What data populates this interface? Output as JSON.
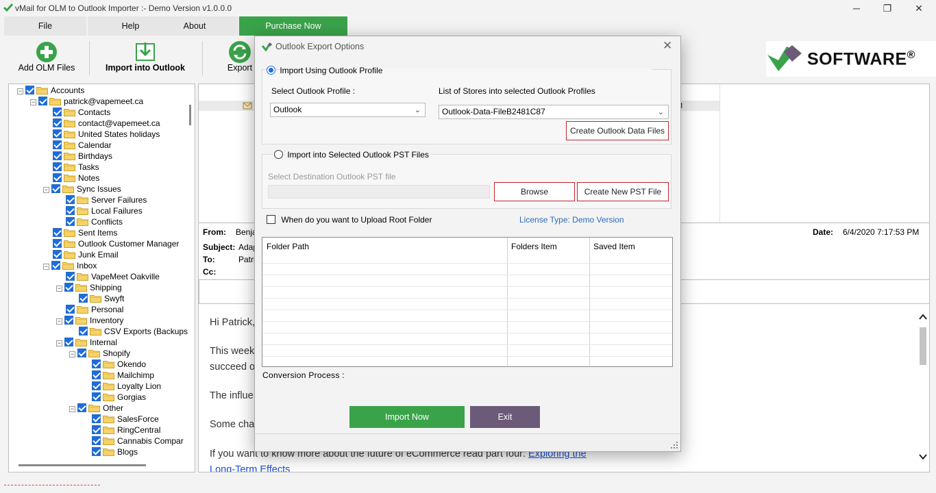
{
  "window": {
    "title": "vMail for OLM to Outlook Importer :- Demo Version v1.0.0.0",
    "minimize": "─",
    "restore": "❐",
    "close": "✕"
  },
  "menu": {
    "file": "File",
    "help": "Help",
    "about": "About",
    "purchase": "Purchase Now"
  },
  "toolbar": {
    "add_olm": "Add OLM Files",
    "import_outlook": "Import into Outlook",
    "export": "Export"
  },
  "brand": {
    "word": "SOFTWARE",
    "reg": "®"
  },
  "tree": {
    "nodes": [
      {
        "label": "Accounts"
      },
      {
        "label": "patrick@vapemeet.ca"
      },
      {
        "label": "Contacts"
      },
      {
        "label": "contact@vapemeet.ca"
      },
      {
        "label": "United States holidays"
      },
      {
        "label": "Calendar"
      },
      {
        "label": "Birthdays"
      },
      {
        "label": "Tasks"
      },
      {
        "label": "Notes"
      },
      {
        "label": "Sync Issues"
      },
      {
        "label": "Server Failures"
      },
      {
        "label": "Local Failures"
      },
      {
        "label": "Conflicts"
      },
      {
        "label": "Sent Items"
      },
      {
        "label": "Outlook Customer Manager"
      },
      {
        "label": "Junk Email"
      },
      {
        "label": "Inbox"
      },
      {
        "label": "VapeMeet Oakville"
      },
      {
        "label": "Shipping"
      },
      {
        "label": "Swyft"
      },
      {
        "label": "Personal"
      },
      {
        "label": "Inventory"
      },
      {
        "label": "CSV Exports (Backups"
      },
      {
        "label": "Internal"
      },
      {
        "label": "Shopify"
      },
      {
        "label": "Okendo"
      },
      {
        "label": "Mailchimp"
      },
      {
        "label": "Loyalty Lion"
      },
      {
        "label": "Gorgias"
      },
      {
        "label": "Other"
      },
      {
        "label": "SalesForce"
      },
      {
        "label": "RingCentral"
      },
      {
        "label": "Cannabis Compar"
      },
      {
        "label": "Blogs"
      }
    ]
  },
  "mail": {
    "grid_fragment": "M",
    "from_label": "From:",
    "from_value": "Benja",
    "subject_label": "Subject:",
    "subject_value": "Adap",
    "to_label": "To:",
    "to_value": "Patric",
    "cc_label": "Cc:",
    "date_label": "Date:",
    "date_value": "6/4/2020 7:17:53 PM",
    "body": {
      "greeting": "Hi Patrick,",
      "line1": "This week",
      "line2": "succeed o",
      "line3": "The influe",
      "line4": "Some cha",
      "line5_text": "If you want to know more about the future of eCommerce read part four: ",
      "line5_link": "Exploring the",
      "line6_link": "Long-Term Effects"
    }
  },
  "dialog": {
    "title": "Outlook Export Options",
    "close": "✕",
    "opt_profile": "Import Using Outlook Profile",
    "select_profile_label": "Select Outlook Profile :",
    "profile_value": "Outlook",
    "stores_label": "List of Stores into selected Outlook Profiles",
    "store_value": "Outlook-Data-FileB2481C87",
    "create_data_files": "Create Outlook Data Files",
    "opt_pst": "Import into Selected Outlook PST Files",
    "dest_pst_label": "Select Destination Outlook PST file",
    "browse": "Browse",
    "create_pst": "Create New PST File",
    "root_folder_label": "When do you want to Upload Root Folder",
    "license": "License Type: Demo Version",
    "table_headers": {
      "path": "Folder Path",
      "items": "Folders Item",
      "saved": "Saved Item"
    },
    "conversion_label": "Conversion Process :",
    "import_now": "Import Now",
    "exit": "Exit"
  },
  "colors": {
    "accent_green": "#3aa34a",
    "check_blue": "#1d6ce0",
    "exit_purple": "#6b5a78",
    "border_red": "#c0272d"
  }
}
